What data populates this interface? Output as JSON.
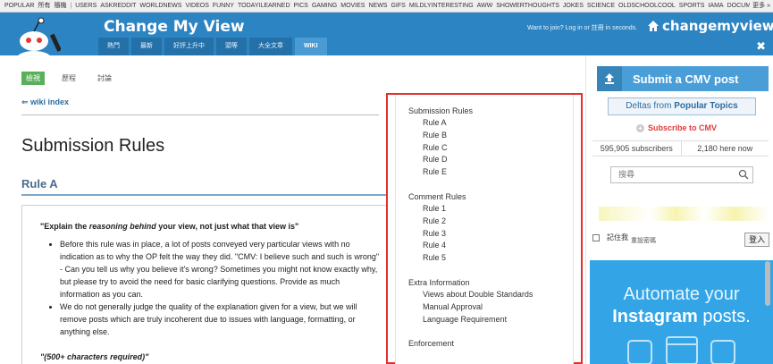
{
  "srbar": {
    "lead": [
      "POPULAR",
      "所有",
      "隨機"
    ],
    "items": [
      "USERS",
      "ASKREDDIT",
      "WORLDNEWS",
      "VIDEOS",
      "FUNNY",
      "TODAYILEARNED",
      "PICS",
      "GAMING",
      "MOVIES",
      "NEWS",
      "GIFS",
      "MILDLYINTERESTING",
      "AWW",
      "SHOWERTHOUGHTS",
      "JOKES",
      "SCIENCE",
      "OLDSCHOOLCOOL",
      "SPORTS",
      "IAMA",
      "DOCUMENTAI"
    ],
    "more": "更多 »"
  },
  "header": {
    "site_name": "Change My View",
    "tabs": [
      "熱門",
      "最新",
      "好評上升中",
      "頭等",
      "大全文章",
      "WIKI"
    ],
    "active_tab": 5,
    "login_msg": "Want to join? Log in or 註冊 in seconds.",
    "cmv_link": "changemyview.net",
    "close": "✖"
  },
  "wiki": {
    "tabs": [
      "檢視",
      "歷程",
      "討論"
    ],
    "index_link": "⇐ wiki index",
    "title": "Submission Rules",
    "rule_a_heading": "Rule A",
    "rule_a_intro_prefix": "\"Explain the ",
    "rule_a_intro_em": "reasoning behind",
    "rule_a_intro_suffix": " your view, not just what that view is\"",
    "bullets": [
      "Before this rule was in place, a lot of posts conveyed very particular views with no indication as to why the OP felt the way they did. \"CMV: I believe such and such is wrong\" - Can you tell us why you believe it's wrong? Sometimes you might not know exactly why, but please try to avoid the need for basic clarifying questions. Provide as much information as you can.",
      "We do not generally judge the quality of the explanation given for a view, but we will remove posts which are truly incoherent due to issues with language, formatting, or anything else."
    ],
    "footnote": "\"(500+ characters required)\""
  },
  "toc": {
    "groups": [
      {
        "head": "Submission Rules",
        "items": [
          "Rule A",
          "Rule B",
          "Rule C",
          "Rule D",
          "Rule E"
        ]
      },
      {
        "head": "Comment Rules",
        "items": [
          "Rule 1",
          "Rule 2",
          "Rule 3",
          "Rule 4",
          "Rule 5"
        ]
      },
      {
        "head": "Extra Information",
        "items": [
          "Views about Double Standards",
          "Manual Approval",
          "Language Requirement"
        ]
      },
      {
        "head": "Enforcement",
        "items": []
      }
    ]
  },
  "sidebar": {
    "submit_label": "Submit a CMV post",
    "deltas_prefix": "Deltas from ",
    "deltas_bold": "Popular Topics",
    "subscribe": "Subscribe to CMV",
    "subscribers": "595,905 subscribers",
    "here_now": "2,180 here now",
    "search_placeholder": "搜尋",
    "remember_me": "記住我",
    "reset_password": "重設密碼",
    "login_button": "登入"
  },
  "ad": {
    "line1": "Automate your",
    "line2_bold": "Instagram",
    "line2_rest": " posts."
  },
  "colors": {
    "header_blue": "#2d84c2",
    "toc_highlight": "#e2312e",
    "ad_blue": "#33a5e6"
  }
}
